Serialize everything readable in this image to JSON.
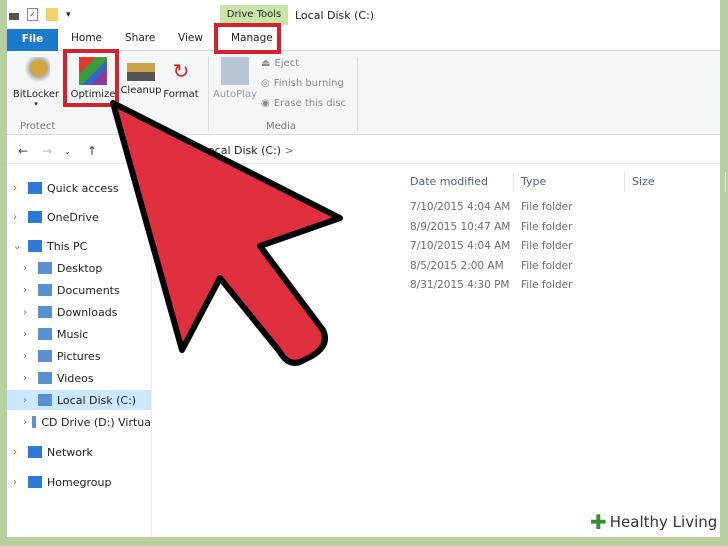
{
  "titlebar": {
    "contextual_tab_group": "Drive Tools",
    "window_title": "Local Disk (C:)"
  },
  "tabs": [
    "File",
    "Home",
    "Share",
    "View",
    "Manage"
  ],
  "ribbon": {
    "buttons": [
      "BitLocker",
      "Optimize",
      "Cleanup",
      "Format",
      "AutoPlay"
    ],
    "media_small": [
      "Eject",
      "Finish burning",
      "Erase this disc"
    ],
    "groups": [
      "Protect",
      "Media"
    ]
  },
  "address": {
    "path": "Local Disk (C:)",
    "separator": ">"
  },
  "sidebar": [
    {
      "label": "Quick access",
      "level": 0,
      "expanded": false
    },
    {
      "label": "OneDrive",
      "level": 0,
      "expanded": false
    },
    {
      "label": "This PC",
      "level": 0,
      "expanded": true
    },
    {
      "label": "Desktop",
      "level": 1
    },
    {
      "label": "Documents",
      "level": 1
    },
    {
      "label": "Downloads",
      "level": 1
    },
    {
      "label": "Music",
      "level": 1
    },
    {
      "label": "Pictures",
      "level": 1
    },
    {
      "label": "Videos",
      "level": 1
    },
    {
      "label": "Local Disk (C:)",
      "level": 1,
      "selected": true
    },
    {
      "label": "CD Drive (D:) Virtua",
      "level": 1
    },
    {
      "label": "Network",
      "level": 0
    },
    {
      "label": "Homegroup",
      "level": 0
    }
  ],
  "columns": [
    "Date modified",
    "Type",
    "Size"
  ],
  "files": [
    {
      "date": "7/10/2015 4:04 AM",
      "type": "File folder"
    },
    {
      "date": "8/9/2015 10:47 AM",
      "type": "File folder"
    },
    {
      "date": "7/10/2015 4:04 AM",
      "type": "File folder"
    },
    {
      "date": "8/5/2015 2:00 AM",
      "type": "File folder"
    },
    {
      "date": "8/31/2015 4:30 PM",
      "type": "File folder"
    }
  ],
  "watermark": "Healthy Living",
  "colors": {
    "highlight": "#d3212f",
    "arrow": "#e03040",
    "file_tab": "#1979ca"
  }
}
